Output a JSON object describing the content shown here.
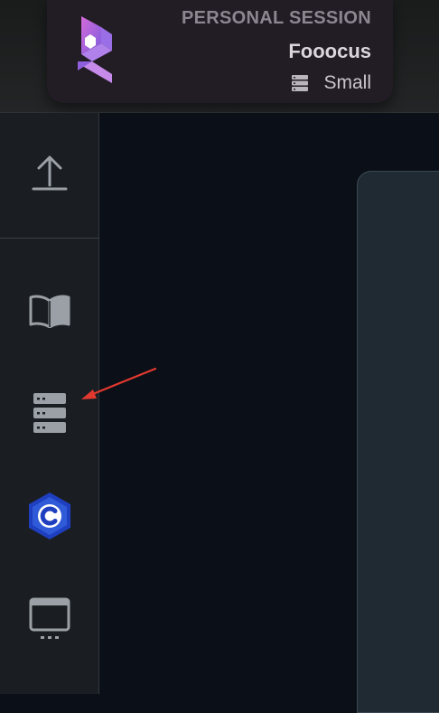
{
  "session": {
    "type_label": "PERSONAL SESSION",
    "name": "Fooocus",
    "size_label": "Small",
    "size_icon": "server-icon",
    "logo_icon": "app-logo-icon"
  },
  "sidebar": {
    "items": [
      {
        "name": "upload-button",
        "icon": "upload-icon"
      },
      {
        "name": "docs-button",
        "icon": "open-book-icon"
      },
      {
        "name": "servers-button",
        "icon": "server-stack-icon"
      },
      {
        "name": "coin-button",
        "icon": "hex-c-icon"
      },
      {
        "name": "screen-button",
        "icon": "monitor-icon"
      }
    ]
  },
  "colors": {
    "accent_purple": "#b57bea",
    "accent_blue": "#2f5bd8",
    "annotation_arrow": "#e0392f",
    "icon_gray": "#9aa0a6"
  }
}
